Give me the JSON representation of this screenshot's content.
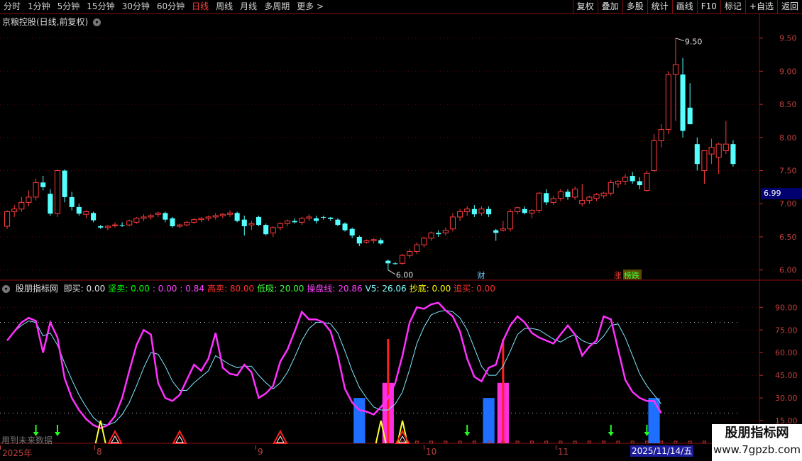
{
  "toolbar": {
    "periods": [
      "分时",
      "1分钟",
      "5分钟",
      "15分钟",
      "30分钟",
      "60分钟",
      "日线",
      "周线",
      "月线",
      "多周期",
      "更多 >"
    ],
    "active_period": "日线",
    "tools": [
      "复权",
      "叠加",
      "多股",
      "统计",
      "画线",
      "F10",
      "标记",
      "+自选",
      "返回"
    ]
  },
  "main_chart": {
    "title": "京粮控股(日线,前复权)",
    "high_label": "9.50",
    "low_label": "6.00",
    "current_price": "6.99",
    "markers": {
      "cai": "财",
      "zhang": "涨",
      "bangdie": "榜跌"
    }
  },
  "indicator": {
    "name": "股朋指标网",
    "items": [
      {
        "label": "即买:",
        "value": "0.00",
        "color": "#e0e0e0"
      },
      {
        "label": "坚卖:",
        "value": "0.00",
        "color": "#00ff00"
      },
      {
        "label": ":",
        "value": "0.00",
        "color": "#ff40ff"
      },
      {
        "label": ":",
        "value": "0.84",
        "color": "#ff40ff"
      },
      {
        "label": "高卖:",
        "value": "80.00",
        "color": "#ff3030"
      },
      {
        "label": "低吸:",
        "value": "20.00",
        "color": "#40ff40"
      },
      {
        "label": "操盘线:",
        "value": "20.86",
        "color": "#ff40ff"
      },
      {
        "label": "V5:",
        "value": "26.06",
        "color": "#7fffff"
      },
      {
        "label": "抄底:",
        "value": "0.00",
        "color": "#ffff00"
      },
      {
        "label": "追买:",
        "value": "0.00",
        "color": "#ff3030"
      }
    ],
    "future_data_note": "用到未来数据"
  },
  "price_axis": [
    "9.50",
    "9.00",
    "8.50",
    "8.00",
    "7.50",
    "7.00",
    "6.50",
    "6.00"
  ],
  "indicator_axis": [
    "90.00",
    "75.00",
    "60.00",
    "45.00",
    "30.00",
    "15.00"
  ],
  "time_axis": {
    "labels": [
      "2025年",
      "8",
      "9",
      "10",
      "11"
    ],
    "selected_date": "2025/11/14/五"
  },
  "watermark": {
    "line1": "股朋指标网",
    "line2": "www.7gpzb.com"
  },
  "chart_data": {
    "type": "candlestick",
    "title": "京粮控股(日线,前复权)",
    "ylim": [
      5.9,
      9.7
    ],
    "candles": [
      [
        6.66,
        6.9,
        6.62,
        6.88
      ],
      [
        6.88,
        6.98,
        6.8,
        6.92
      ],
      [
        6.92,
        7.1,
        6.88,
        7.02
      ],
      [
        7.02,
        7.2,
        6.96,
        7.1
      ],
      [
        7.1,
        7.38,
        7.05,
        7.32
      ],
      [
        7.32,
        7.42,
        7.2,
        7.25
      ],
      [
        7.15,
        7.22,
        6.82,
        6.85
      ],
      [
        6.85,
        7.52,
        6.8,
        7.5
      ],
      [
        7.5,
        7.52,
        7.02,
        7.1
      ],
      [
        7.1,
        7.18,
        6.9,
        6.95
      ],
      [
        6.95,
        7.0,
        6.82,
        6.85
      ],
      [
        6.84,
        6.9,
        6.78,
        6.88
      ],
      [
        6.86,
        6.88,
        6.72,
        6.75
      ],
      [
        6.66,
        6.68,
        6.62,
        6.64
      ],
      [
        6.64,
        6.68,
        6.6,
        6.66
      ],
      [
        6.67,
        6.72,
        6.64,
        6.68
      ],
      [
        6.68,
        6.72,
        6.65,
        6.67
      ],
      [
        6.68,
        6.76,
        6.66,
        6.74
      ],
      [
        6.72,
        6.8,
        6.7,
        6.78
      ],
      [
        6.78,
        6.84,
        6.74,
        6.8
      ],
      [
        6.8,
        6.85,
        6.76,
        6.82
      ],
      [
        6.84,
        6.88,
        6.8,
        6.86
      ],
      [
        6.86,
        6.88,
        6.72,
        6.76
      ],
      [
        6.78,
        6.8,
        6.64,
        6.66
      ],
      [
        6.66,
        6.7,
        6.63,
        6.68
      ],
      [
        6.68,
        6.74,
        6.66,
        6.72
      ],
      [
        6.72,
        6.78,
        6.7,
        6.76
      ],
      [
        6.76,
        6.8,
        6.72,
        6.78
      ],
      [
        6.78,
        6.82,
        6.74,
        6.8
      ],
      [
        6.8,
        6.86,
        6.76,
        6.82
      ],
      [
        6.82,
        6.86,
        6.78,
        6.84
      ],
      [
        6.84,
        6.9,
        6.8,
        6.86
      ],
      [
        6.86,
        6.88,
        6.72,
        6.74
      ],
      [
        6.76,
        6.82,
        6.52,
        6.66
      ],
      [
        6.68,
        6.74,
        6.6,
        6.7
      ],
      [
        6.8,
        6.82,
        6.66,
        6.68
      ],
      [
        6.68,
        6.7,
        6.52,
        6.54
      ],
      [
        6.56,
        6.66,
        6.5,
        6.64
      ],
      [
        6.64,
        6.72,
        6.6,
        6.7
      ],
      [
        6.7,
        6.76,
        6.66,
        6.74
      ],
      [
        6.74,
        6.78,
        6.7,
        6.72
      ],
      [
        6.72,
        6.8,
        6.68,
        6.78
      ],
      [
        6.78,
        6.84,
        6.74,
        6.8
      ],
      [
        6.78,
        6.82,
        6.7,
        6.74
      ],
      [
        6.8,
        6.82,
        6.76,
        6.79
      ],
      [
        6.79,
        6.8,
        6.74,
        6.77
      ],
      [
        6.76,
        6.78,
        6.66,
        6.68
      ],
      [
        6.7,
        6.72,
        6.58,
        6.6
      ],
      [
        6.62,
        6.64,
        6.48,
        6.52
      ],
      [
        6.5,
        6.52,
        6.36,
        6.4
      ],
      [
        6.42,
        6.46,
        6.4,
        6.44
      ],
      [
        6.44,
        6.48,
        6.4,
        6.46
      ],
      [
        6.45,
        6.48,
        6.38,
        6.4
      ],
      [
        6.14,
        6.16,
        6.0,
        6.1
      ],
      [
        6.1,
        6.12,
        6.08,
        6.09
      ],
      [
        6.1,
        6.24,
        6.08,
        6.22
      ],
      [
        6.22,
        6.32,
        6.18,
        6.28
      ],
      [
        6.28,
        6.42,
        6.24,
        6.38
      ],
      [
        6.38,
        6.5,
        6.34,
        6.48
      ],
      [
        6.48,
        6.58,
        6.44,
        6.56
      ],
      [
        6.56,
        6.6,
        6.5,
        6.54
      ],
      [
        6.56,
        6.64,
        6.52,
        6.6
      ],
      [
        6.62,
        6.86,
        6.58,
        6.8
      ],
      [
        6.8,
        6.92,
        6.74,
        6.88
      ],
      [
        6.88,
        6.96,
        6.82,
        6.92
      ],
      [
        6.92,
        6.98,
        6.8,
        6.84
      ],
      [
        6.86,
        6.96,
        6.82,
        6.92
      ],
      [
        6.92,
        6.96,
        6.8,
        6.84
      ],
      [
        6.6,
        6.62,
        6.44,
        6.56
      ],
      [
        6.6,
        6.74,
        6.58,
        6.62
      ],
      [
        6.62,
        6.92,
        6.58,
        6.88
      ],
      [
        6.88,
        6.96,
        6.84,
        6.94
      ],
      [
        6.92,
        6.96,
        6.84,
        6.86
      ],
      [
        6.86,
        6.92,
        6.78,
        6.9
      ],
      [
        6.9,
        7.18,
        6.86,
        7.16
      ],
      [
        7.16,
        7.22,
        6.98,
        7.02
      ],
      [
        7.02,
        7.12,
        6.98,
        7.08
      ],
      [
        7.08,
        7.22,
        7.04,
        7.18
      ],
      [
        7.18,
        7.22,
        7.06,
        7.1
      ],
      [
        7.1,
        7.26,
        7.06,
        7.22
      ],
      [
        7.0,
        7.3,
        6.96,
        7.05
      ],
      [
        7.05,
        7.12,
        7.0,
        7.1
      ],
      [
        7.08,
        7.16,
        7.04,
        7.14
      ],
      [
        7.12,
        7.18,
        7.08,
        7.16
      ],
      [
        7.16,
        7.36,
        7.12,
        7.32
      ],
      [
        7.3,
        7.36,
        7.24,
        7.34
      ],
      [
        7.34,
        7.45,
        7.28,
        7.4
      ],
      [
        7.42,
        7.48,
        7.3,
        7.34
      ],
      [
        7.34,
        7.4,
        7.22,
        7.28
      ],
      [
        7.2,
        7.5,
        7.18,
        7.46
      ],
      [
        7.5,
        8.05,
        7.48,
        7.95
      ],
      [
        7.95,
        8.2,
        7.85,
        8.12
      ],
      [
        8.12,
        9.0,
        8.05,
        8.95
      ],
      [
        8.95,
        9.5,
        8.25,
        9.1
      ],
      [
        8.95,
        9.2,
        8.0,
        8.1
      ],
      [
        8.45,
        8.82,
        8.2,
        8.2
      ],
      [
        7.9,
        8.0,
        7.5,
        7.6
      ],
      [
        7.5,
        7.8,
        7.3,
        7.8
      ],
      [
        7.75,
        7.98,
        7.6,
        7.85
      ],
      [
        7.7,
        7.92,
        7.45,
        7.9
      ],
      [
        7.8,
        8.25,
        7.75,
        7.9
      ],
      [
        7.9,
        7.96,
        7.56,
        7.6
      ]
    ],
    "indicator": {
      "ylim": [
        0,
        100
      ],
      "cao_pan_xian": [
        68,
        74,
        80,
        83,
        81,
        60,
        80,
        70,
        43,
        30,
        22,
        16,
        12,
        10,
        12,
        18,
        30,
        48,
        65,
        75,
        72,
        40,
        30,
        28,
        32,
        42,
        52,
        48,
        56,
        73,
        50,
        46,
        45,
        52,
        47,
        30,
        33,
        38,
        54,
        62,
        74,
        87,
        82,
        82,
        80,
        74,
        58,
        36,
        27,
        22,
        21,
        19,
        24,
        30,
        40,
        58,
        80,
        90,
        89,
        92,
        93,
        88,
        84,
        74,
        56,
        44,
        41,
        50,
        52,
        68,
        78,
        84,
        80,
        73,
        70,
        68,
        66,
        72,
        78,
        72,
        58,
        64,
        68,
        84,
        82,
        62,
        42,
        34,
        30,
        28,
        28,
        20
      ],
      "v5": [
        68,
        74,
        78,
        81,
        80,
        71,
        73,
        65,
        53,
        42,
        32,
        24,
        17,
        13,
        12,
        14,
        19,
        27,
        38,
        50,
        60,
        59,
        51,
        41,
        35,
        35,
        40,
        44,
        48,
        58,
        55,
        52,
        50,
        51,
        51,
        45,
        40,
        36,
        40,
        47,
        57,
        68,
        76,
        80,
        80,
        79,
        73,
        61,
        48,
        37,
        30,
        24,
        22,
        22,
        26,
        34,
        49,
        66,
        77,
        85,
        87,
        88,
        87,
        83,
        75,
        63,
        51,
        45,
        45,
        51,
        61,
        72,
        76,
        76,
        75,
        72,
        69,
        67,
        70,
        72,
        68,
        66,
        66,
        71,
        78,
        79,
        70,
        58,
        46,
        38,
        32,
        26
      ],
      "blue_bars": [
        {
          "i": 49,
          "v": 30
        },
        {
          "i": 67,
          "v": 30
        },
        {
          "i": 90,
          "v": 30
        }
      ],
      "magenta_bars": [
        {
          "i": 53,
          "v": 40
        },
        {
          "i": 69,
          "v": 40
        }
      ],
      "red_spikes": [
        53,
        69
      ],
      "yellow_triangles": [
        13,
        52,
        55
      ],
      "red_triangles": [
        15,
        24,
        38,
        55
      ],
      "green_arrows": [
        4,
        7,
        64,
        84,
        89
      ]
    }
  }
}
